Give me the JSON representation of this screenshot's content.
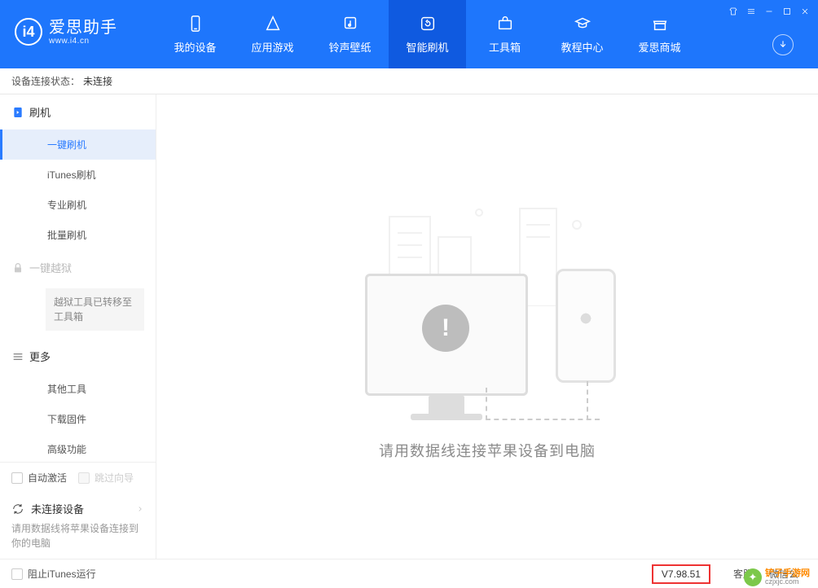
{
  "app": {
    "title": "爱思助手",
    "subtitle": "www.i4.cn"
  },
  "nav": {
    "tabs": [
      {
        "label": "我的设备"
      },
      {
        "label": "应用游戏"
      },
      {
        "label": "铃声壁纸"
      },
      {
        "label": "智能刷机"
      },
      {
        "label": "工具箱"
      },
      {
        "label": "教程中心"
      },
      {
        "label": "爱思商城"
      }
    ],
    "active_index": 3
  },
  "status": {
    "label": "设备连接状态：",
    "value": "未连接"
  },
  "sidebar": {
    "groups": [
      {
        "title": "刷机",
        "items": [
          {
            "label": "一键刷机",
            "active": true
          },
          {
            "label": "iTunes刷机"
          },
          {
            "label": "专业刷机"
          },
          {
            "label": "批量刷机"
          }
        ]
      },
      {
        "title": "一键越狱",
        "locked": true,
        "note": "越狱工具已转移至工具箱"
      },
      {
        "title": "更多",
        "items": [
          {
            "label": "其他工具"
          },
          {
            "label": "下载固件"
          },
          {
            "label": "高级功能"
          }
        ]
      }
    ],
    "auto_activate": "自动激活",
    "skip_wizard": "跳过向导",
    "device_title": "未连接设备",
    "device_hint": "请用数据线将苹果设备连接到你的电脑"
  },
  "main": {
    "hint": "请用数据线连接苹果设备到电脑"
  },
  "footer": {
    "block_itunes": "阻止iTunes运行",
    "version": "V7.98.51",
    "links": [
      "客服",
      "微信公"
    ]
  },
  "watermark": {
    "name": "铲子手游网",
    "url": "czjxjc.com"
  }
}
